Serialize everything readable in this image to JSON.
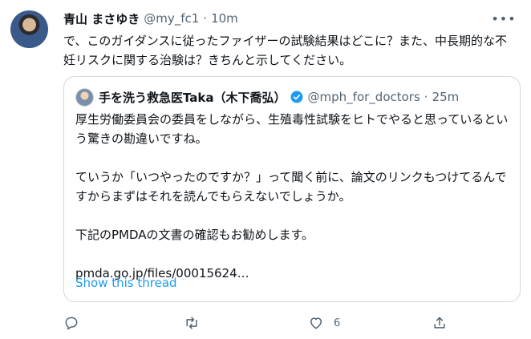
{
  "tweet": {
    "author_name": "青山 まさゆき",
    "author_handle": "@my_fc1",
    "separator": "·",
    "time": "10m",
    "text": "で、このガイダンスに従ったファイザーの試験結果はどこに？また、中長期的な不妊リスクに関する治験は？きちんと示してください。"
  },
  "quote": {
    "author_name": "手を洗う救急医Taka（木下喬弘）",
    "author_handle": "@mph_for_doctors",
    "separator": "·",
    "time": "25m",
    "paragraphs": [
      "厚生労働委員会の委員をしながら、生殖毒性試験をヒトでやると思っているという驚きの勘違いですね。",
      "ていうか「いつやったのですか？」って聞く前に、論文のリンクもつけてるんですからまずはそれを読んでもらえないでしょうか。",
      "下記のPMDAの文書の確認もお勧めします。",
      "pmda.go.jp/files/00015624…"
    ],
    "show_thread": "Show this thread"
  },
  "actions": {
    "reply": {
      "icon": "reply-icon"
    },
    "retweet": {
      "icon": "retweet-icon"
    },
    "like": {
      "icon": "heart-icon",
      "count": "6"
    },
    "share": {
      "icon": "share-icon"
    }
  },
  "colors": {
    "accent": "#1d9bf0",
    "muted": "#536471",
    "text": "#0f1419",
    "border": "#cfd9de"
  }
}
